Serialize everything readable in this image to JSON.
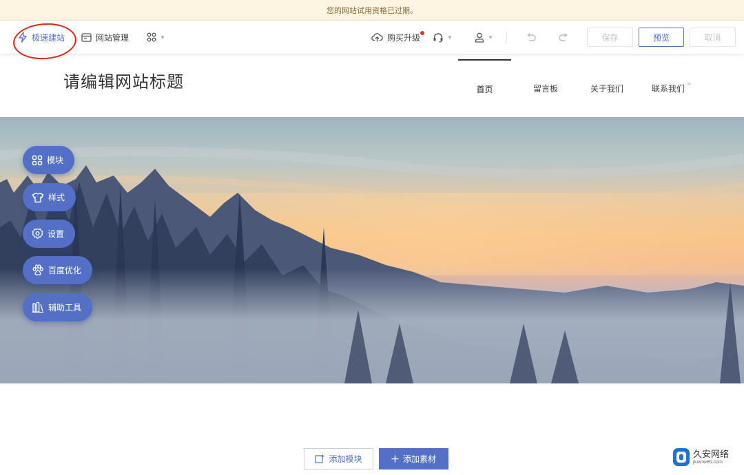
{
  "notice": "您的网站试用资格已过期。",
  "toolbar": {
    "quick_build": "极速建站",
    "site_manage": "网站管理",
    "buy_upgrade": "购买升级",
    "save": "保存",
    "preview": "预览",
    "cancel": "取消",
    "accent_color": "#5470c6"
  },
  "site": {
    "title": "请编辑网站标题",
    "nav": [
      "首页",
      "留言板",
      "关于我们",
      "联系我们"
    ],
    "active_nav": "首页"
  },
  "side_panel": {
    "modules": "模块",
    "style": "样式",
    "settings": "设置",
    "baidu_seo": "百度优化",
    "tools": "辅助工具"
  },
  "actions": {
    "add_module": "添加模块",
    "add_material": "添加素材"
  },
  "watermark": {
    "name": "久安网络",
    "url": "jiuanweb.com"
  }
}
